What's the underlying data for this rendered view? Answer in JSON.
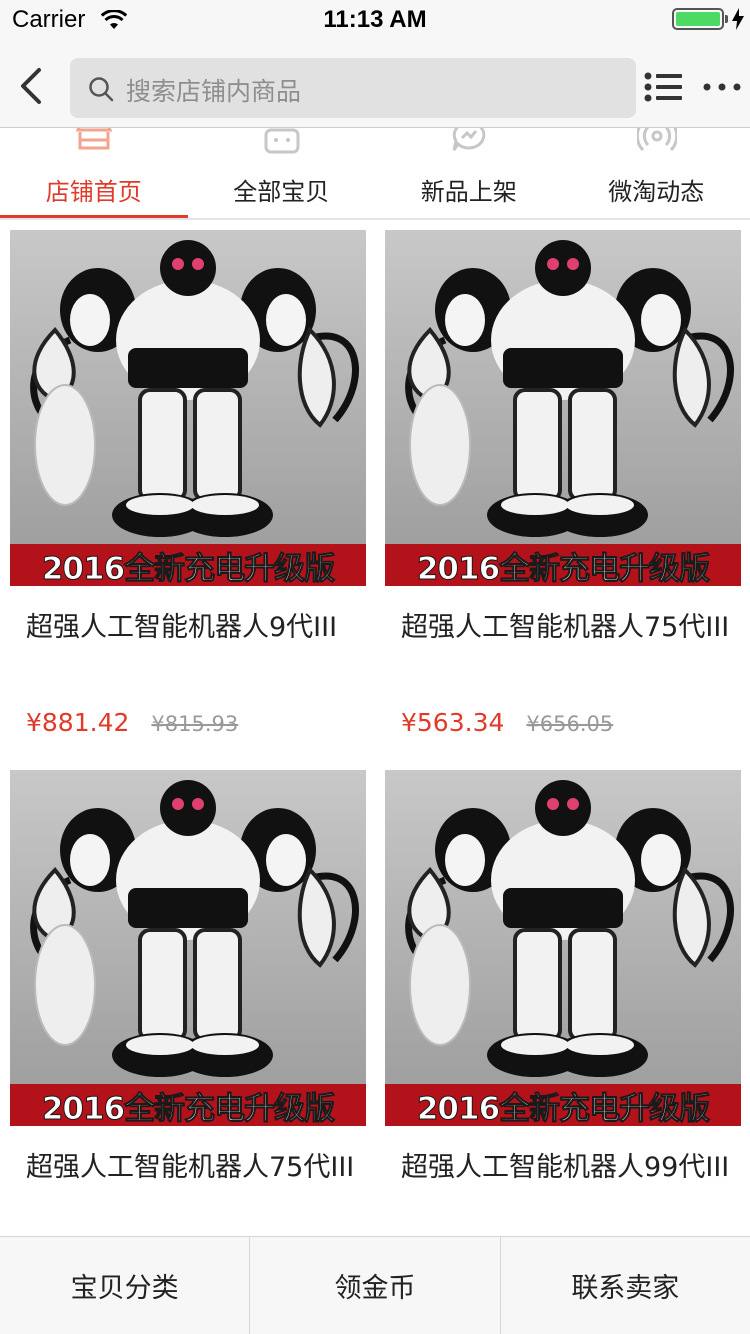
{
  "status_bar": {
    "carrier": "Carrier",
    "time": "11:13 AM",
    "battery_level": 1.0,
    "charging": true
  },
  "nav": {
    "back_icon": "chevron-left-icon",
    "search_placeholder": "搜索店铺内商品",
    "list_icon": "list-icon",
    "more_icon": "more-dots-icon"
  },
  "tabs": [
    {
      "label": "店铺首页",
      "icon": "shop-icon",
      "active": true
    },
    {
      "label": "全部宝贝",
      "icon": "bag-icon",
      "active": false
    },
    {
      "label": "新品上架",
      "icon": "chat-bolt-icon",
      "active": false
    },
    {
      "label": "微淘动态",
      "icon": "signal-icon",
      "active": false
    }
  ],
  "colors": {
    "accent": "#e03a2b",
    "banner_red": "#b3121a",
    "old_price_gray": "#999999",
    "battery_green": "#4cd964"
  },
  "products": [
    {
      "banner": "2016全新充电升级版",
      "title": "超强人工智能机器人9代III",
      "price": "¥881.42",
      "old_price": "¥815.93"
    },
    {
      "banner": "2016全新充电升级版",
      "title": "超强人工智能机器人75代III",
      "price": "¥563.34",
      "old_price": "¥656.05"
    },
    {
      "banner": "2016全新充电升级版",
      "title": "超强人工智能机器人75代III",
      "price": "",
      "old_price": ""
    },
    {
      "banner": "2016全新充电升级版",
      "title": "超强人工智能机器人99代III",
      "price": "",
      "old_price": ""
    }
  ],
  "toolbar": {
    "category_label": "宝贝分类",
    "coins_label": "领金币",
    "contact_label": "联系卖家"
  }
}
